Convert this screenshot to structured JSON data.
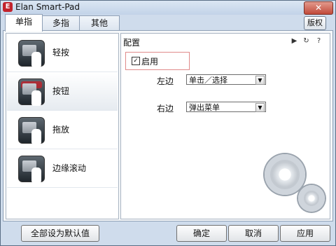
{
  "window": {
    "title": "Elan Smart-Pad",
    "close_label": "✕"
  },
  "tabs": [
    {
      "label": "单指",
      "active": true
    },
    {
      "label": "多指",
      "active": false
    },
    {
      "label": "其他",
      "active": false
    }
  ],
  "header": {
    "about_label": "版权"
  },
  "sidebar": {
    "items": [
      {
        "label": "轻按",
        "selected": false
      },
      {
        "label": "按钮",
        "selected": true
      },
      {
        "label": "拖放",
        "selected": false
      },
      {
        "label": "边缘滚动",
        "selected": false
      }
    ]
  },
  "config": {
    "title": "配置",
    "enable_label": "启用",
    "enabled": true,
    "left_label": "左边",
    "left_value": "单击／选择",
    "right_label": "右边",
    "right_value": "弹出菜单"
  },
  "footer": {
    "defaults_label": "全部设为默认值",
    "ok_label": "确定",
    "cancel_label": "取消",
    "apply_label": "应用"
  }
}
